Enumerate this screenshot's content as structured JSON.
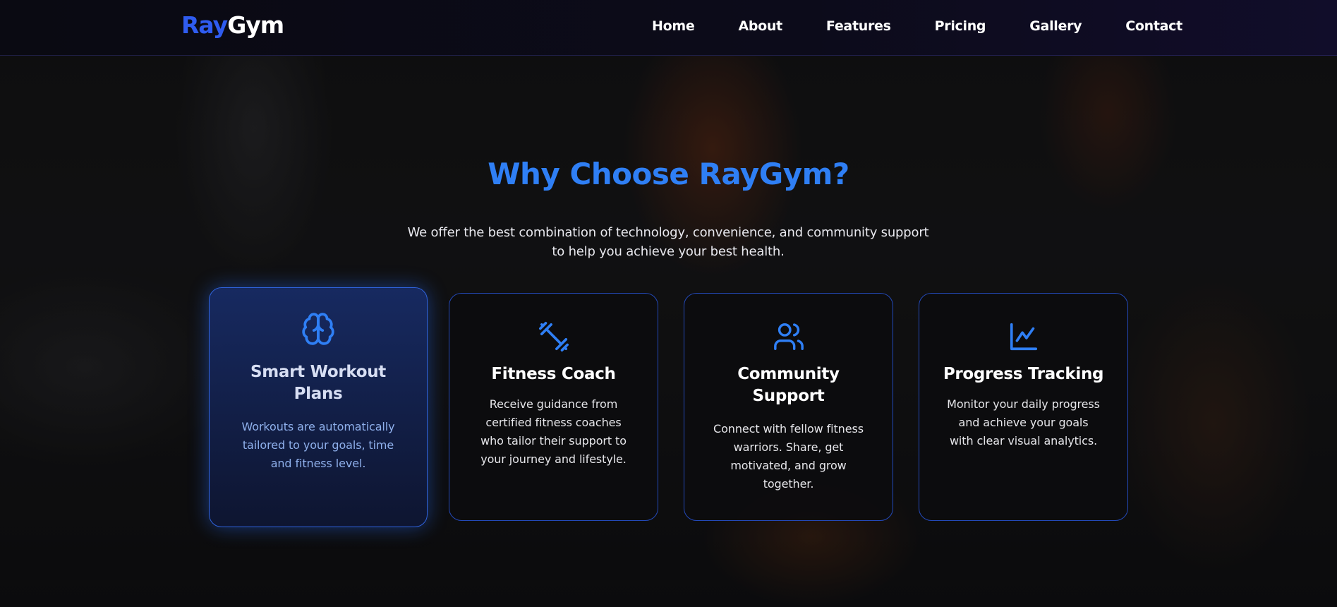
{
  "header": {
    "logo": {
      "part1": "Ray",
      "part2": "Gym"
    },
    "nav": [
      "Home",
      "About",
      "Features",
      "Pricing",
      "Gallery",
      "Contact"
    ]
  },
  "section": {
    "title": "Why Choose RayGym?",
    "subtitle_line1": "We offer the best combination of technology, convenience, and community support",
    "subtitle_line2": "to help you achieve your best health."
  },
  "cards": [
    {
      "icon": "brain-icon",
      "title_line1": "Smart Workout",
      "title_line2": "Plans",
      "desc_lines": [
        "Workouts are automatically",
        "tailored to your goals, time",
        "and fitness level."
      ]
    },
    {
      "icon": "dumbbell-icon",
      "title_line1": "Fitness Coach",
      "desc_lines": [
        "Receive guidance from",
        "certified fitness coaches",
        "who tailor their support to",
        "your journey and lifestyle."
      ]
    },
    {
      "icon": "users-icon",
      "title_line1": "Community",
      "title_line2": "Support",
      "desc_lines": [
        "Connect with fellow fitness",
        "warriors. Share, get",
        "motivated, and grow",
        "together."
      ]
    },
    {
      "icon": "chart-line-icon",
      "title_line1": "Progress Tracking",
      "desc_lines": [
        "Monitor your daily progress",
        "and achieve your goals",
        "with clear visual analytics."
      ]
    }
  ],
  "colors": {
    "accent": "#2f7ff5",
    "logo_blue": "#2f5cf0",
    "card_border": "#2349b8"
  }
}
